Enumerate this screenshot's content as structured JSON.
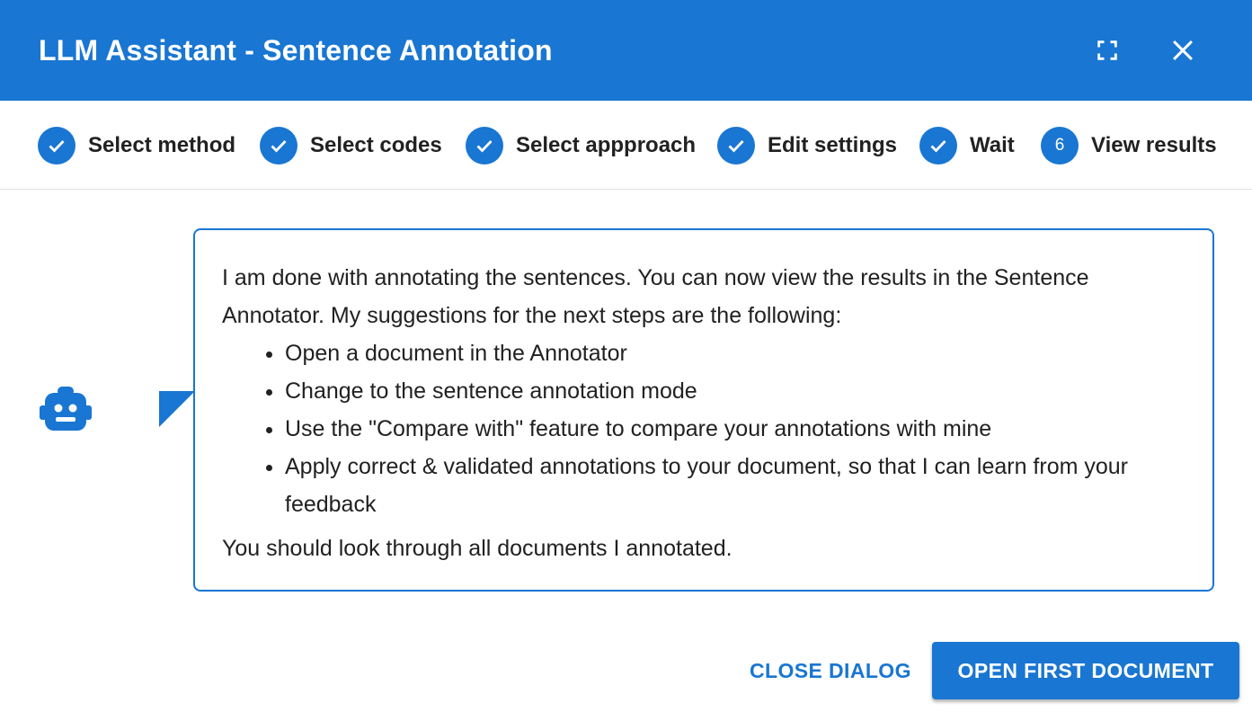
{
  "dialog": {
    "title": "LLM Assistant - Sentence Annotation",
    "fullscreen_icon": "fullscreen-icon",
    "close_icon": "close-icon",
    "accent_color": "#1976d2"
  },
  "stepper": {
    "steps": [
      {
        "label": "Select method",
        "state": "completed",
        "icon": "check-icon"
      },
      {
        "label": "Select codes",
        "state": "completed",
        "icon": "check-icon"
      },
      {
        "label": "Select appproach",
        "state": "completed",
        "icon": "check-icon"
      },
      {
        "label": "Edit settings",
        "state": "completed",
        "icon": "check-icon"
      },
      {
        "label": "Wait",
        "state": "completed",
        "icon": "check-icon"
      },
      {
        "label": "View results",
        "state": "active",
        "number": "6"
      }
    ]
  },
  "message": {
    "avatar_icon": "robot-icon",
    "intro": "I am done with annotating the sentences. You can now view the results in the Sentence Annotator. My suggestions for the next steps are the following:",
    "items": [
      "Open a document in the Annotator",
      "Change to the sentence annotation mode",
      "Use the \"Compare with\" feature to compare your annotations with mine",
      "Apply correct & validated annotations to your document, so that I can learn from your feedback"
    ],
    "outro": "You should look through all documents I annotated."
  },
  "actions": {
    "close_label": "CLOSE DIALOG",
    "open_label": "OPEN FIRST DOCUMENT"
  }
}
